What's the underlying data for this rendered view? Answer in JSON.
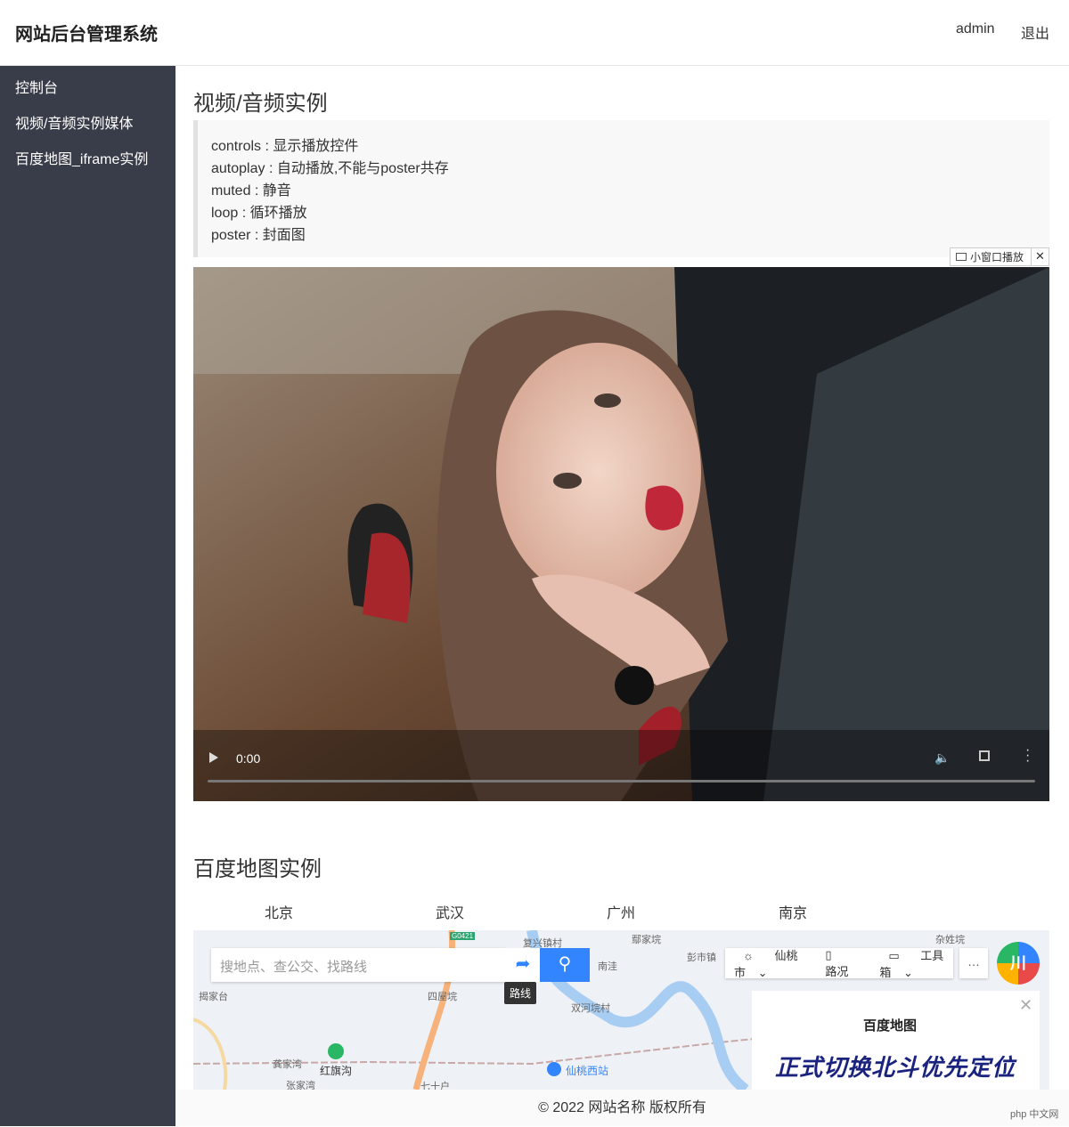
{
  "header": {
    "brand": "网站后台管理系统",
    "user": "admin",
    "logout": "退出"
  },
  "sidebar": {
    "items": [
      {
        "label": "控制台"
      },
      {
        "label": "视频/音频实例媒体"
      },
      {
        "label": "百度地图_iframe实例"
      }
    ]
  },
  "video_section": {
    "title": "视频/音频实例",
    "notes": [
      "controls : 显示播放控件",
      "autoplay : 自动播放,不能与poster共存",
      "muted : 静音",
      "loop : 循环播放",
      "poster : 封面图"
    ],
    "pip_label": "小窗口播放",
    "pip_close": "✕",
    "time": "0:00",
    "progress": 0
  },
  "map_section": {
    "title": "百度地图实例",
    "cities": [
      "北京",
      "武汉",
      "广州",
      "南京"
    ],
    "search_placeholder": "搜地点、查公交、找路线",
    "route_tooltip": "路线",
    "toolbar": {
      "city": "仙桃市",
      "traffic": "路况",
      "tools": "工具箱"
    },
    "places": [
      "复兴镇村",
      "鄢家垸",
      "杂姓垸",
      "南洼",
      "彭市镇",
      "揭家台",
      "四屋垸",
      "双河垸村",
      "红旗沟",
      "龚家湾",
      "张家湾",
      "七十户",
      "仙桃西站",
      "G0421"
    ],
    "ad": {
      "logo": "百度地图",
      "text": "正式切换北斗优先定位",
      "close": "✕"
    }
  },
  "footer": {
    "copyright": "© 2022 网站名称 版权所有"
  },
  "badge": "php 中文网"
}
